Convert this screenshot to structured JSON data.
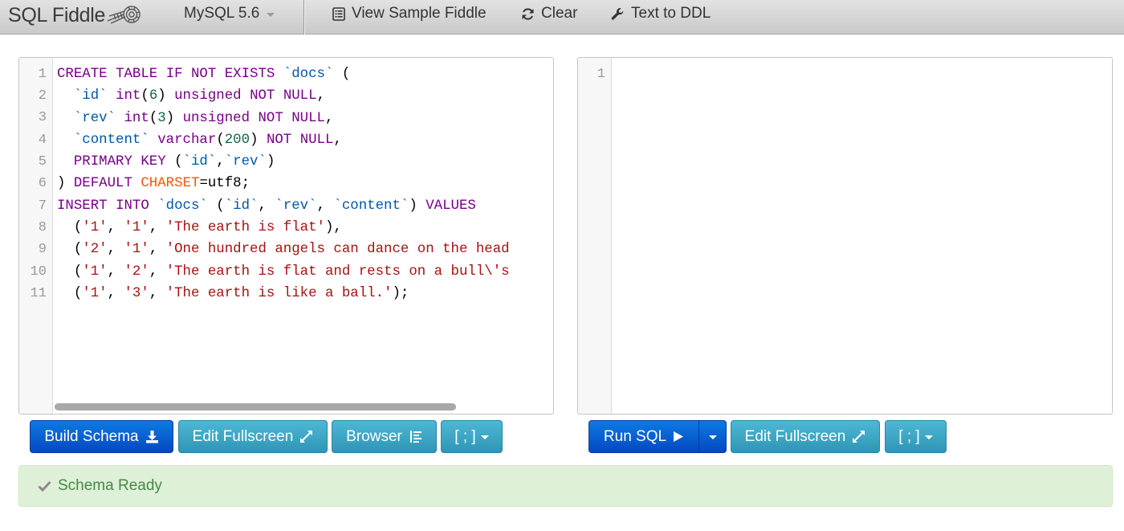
{
  "navbar": {
    "brand": "SQL Fiddle",
    "db_version": "MySQL 5.6",
    "view_sample": "View Sample Fiddle",
    "clear": "Clear",
    "text_to_ddl": "Text to DDL"
  },
  "schema_editor": {
    "line_numbers": [
      "1",
      "2",
      "3",
      "4",
      "5",
      "6",
      "7",
      "8",
      "9",
      "10",
      "11"
    ]
  },
  "query_editor": {
    "line_numbers": [
      "1"
    ]
  },
  "schema_buttons": {
    "build": "Build Schema",
    "fullscreen": "Edit Fullscreen",
    "browser": "Browser",
    "delimiter": "[ ; ]"
  },
  "query_buttons": {
    "run": "Run SQL",
    "fullscreen": "Edit Fullscreen",
    "delimiter": "[ ; ]"
  },
  "status": {
    "message": "Schema Ready"
  },
  "colors": {
    "keyword": "#770088",
    "identifier": "#0055aa",
    "number": "#116644",
    "string": "#aa1111",
    "variable": "#ff5500",
    "primary_button": "#0448c2",
    "info_button": "#2f96b4",
    "success_text": "#468847",
    "success_bg": "#dff0d8"
  }
}
